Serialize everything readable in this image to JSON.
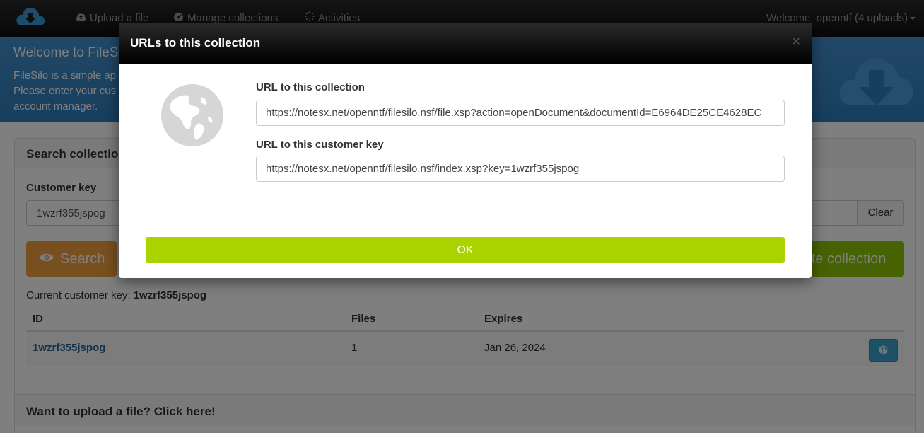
{
  "navbar": {
    "brand_icon": "cloud-download-icon",
    "upload_label": "Upload a file",
    "collections_label": "Manage collections",
    "activities_label": "Activities",
    "welcome_label": "Welcome, openntf (4 uploads)"
  },
  "hero": {
    "title": "Welcome to FileS",
    "line1": "FileSilo is a simple ap",
    "line2": "Please enter your cus",
    "line3": "account manager."
  },
  "search": {
    "header": "Search collectio",
    "customer_key_label": "Customer key",
    "customer_key_value": "1wzrf355jspog",
    "clear_label": "Clear",
    "search_label": "Search",
    "create_label": "ate collection",
    "current_key_label": "Current customer key:",
    "current_key_value": "1wzrf355jspog"
  },
  "table": {
    "headers": [
      "ID",
      "Files",
      "Expires"
    ],
    "rows": [
      {
        "id": "1wzrf355jspog",
        "files": "1",
        "expires": "Jan 26, 2024"
      }
    ]
  },
  "footer_panel": {
    "upload_prompt": "Want to upload a file? Click here!"
  },
  "modal": {
    "title": "URLs to this collection",
    "close_glyph": "×",
    "collection_url_label": "URL to this collection",
    "collection_url_value": "https://notesx.net/openntf/filesilo.nsf/file.xsp?action=openDocument&documentId=E6964DE25CE4628EC",
    "key_url_label": "URL to this customer key",
    "key_url_value": "https://notesx.net/openntf/filesilo.nsf/index.xsp?key=1wzrf355jspog",
    "ok_label": "OK"
  },
  "colors": {
    "hero_blue": "#3a87c8",
    "search_orange": "#f0a040",
    "create_green": "#8fc400",
    "ok_green": "#aad400",
    "link_blue": "#2a6496"
  }
}
